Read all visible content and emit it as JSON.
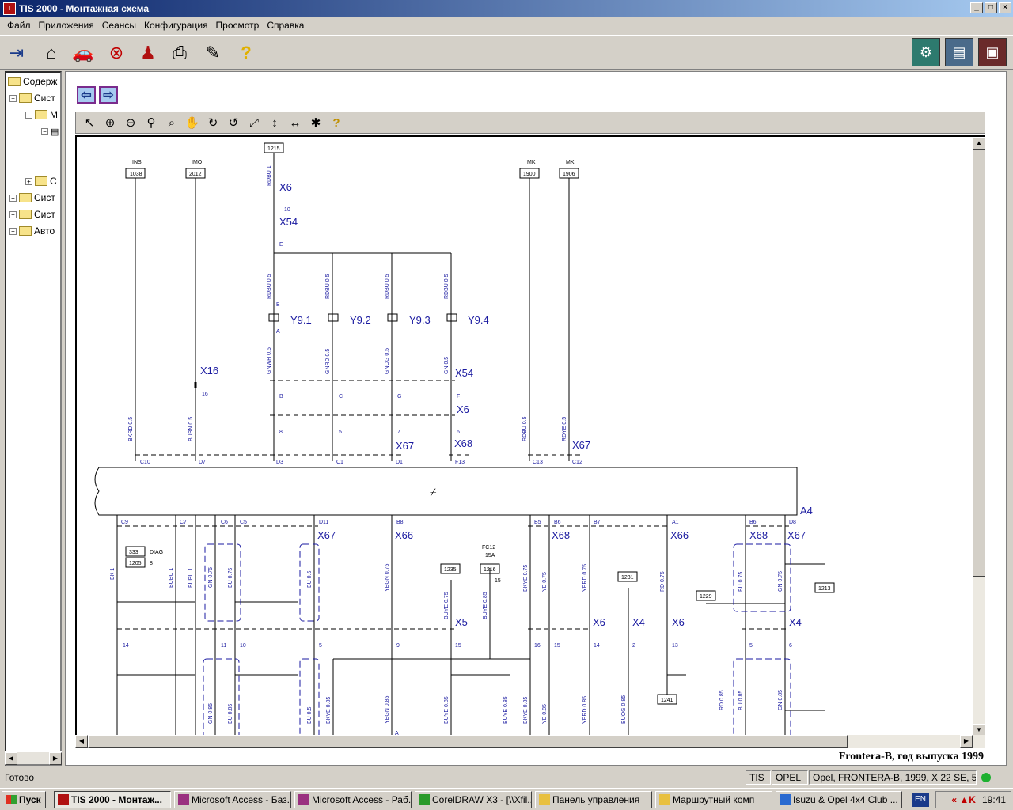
{
  "window": {
    "title": "TIS 2000 - Монтажная схема",
    "controls": [
      "_",
      "□",
      "×"
    ]
  },
  "menu": [
    "Файл",
    "Приложения",
    "Сеансы",
    "Конфигурация",
    "Просмотр",
    "Справка"
  ],
  "toolbar": {
    "icons": [
      "exit-icon",
      "home-icon",
      "car-icon",
      "stop-icon",
      "person-icon",
      "printer-icon",
      "notes-icon",
      "help-icon"
    ],
    "right_icons": [
      "vehicle-app-1-icon",
      "vehicle-app-2-icon",
      "vehicle-app-3-icon"
    ]
  },
  "tree": {
    "items": [
      {
        "label": "Содерж"
      },
      {
        "label": "Сист"
      },
      {
        "label": "М"
      },
      {
        "label": ""
      },
      {
        "label": "С"
      },
      {
        "label": "Сист"
      },
      {
        "label": "Сист"
      },
      {
        "label": "Авто"
      }
    ]
  },
  "viewer_toolbar": {
    "icons": [
      "pointer-icon",
      "zoom-in-icon",
      "zoom-out-icon",
      "zoom-icon",
      "zoom-area-icon",
      "pan-hand-icon",
      "rotate-cw-icon",
      "rotate-ccw-icon",
      "fit-window-icon",
      "fit-height-icon",
      "fit-width-icon",
      "highlight-icon",
      "help-icon"
    ]
  },
  "diagram": {
    "top_boxes": {
      "ins_label": "INS",
      "ins": "1038",
      "imo_label": "IMO",
      "imo": "2012",
      "b1215": "1215",
      "mk1_label": "MK",
      "mk1": "1900",
      "mk2_label": "MK",
      "mk2": "1906"
    },
    "connectors": {
      "x6": "X6",
      "x54": "X54",
      "x16": "X16",
      "x67": "X67",
      "x68": "X68",
      "x66": "X66",
      "x5": "X5",
      "x4": "X4",
      "a4": "A4"
    },
    "valves": [
      "Y9.1",
      "Y9.2",
      "Y9.3",
      "Y9.4"
    ],
    "wires_top": [
      "RDBU 1",
      "RDBU 0.5",
      "RDBU 0.5",
      "RDBU 0.5",
      "RDBU 0.5",
      "GNWH 0.5",
      "GNRD 0.5",
      "GNOG 0.5",
      "GN 0.5",
      "BKRD 0.5",
      "BUBN 0.5",
      "RDBU 0.5",
      "RDYE 0.5"
    ],
    "pins_top": [
      "10",
      "E",
      "B",
      "A",
      "B",
      "C",
      "G",
      "F",
      "8",
      "5",
      "7",
      "6",
      "16",
      "C10",
      "D7",
      "D3",
      "C1",
      "D1",
      "F13",
      "C13",
      "C12"
    ],
    "pins_bottom": [
      "C9",
      "C7",
      "C6",
      "C5",
      "D11",
      "B8",
      "B5",
      "B6",
      "B7",
      "A1",
      "B6",
      "D8"
    ],
    "bottom_boxes": {
      "b333": "333",
      "diag": "DIAG",
      "diag_pin": "8",
      "b1205": "1205",
      "b1235": "1235",
      "fc12": "FC12",
      "fc12_rating": "15A",
      "b1216": "1216",
      "b1216_pin": "15",
      "b1231": "1231",
      "b1229": "1229",
      "b1213": "1213",
      "b1241": "1241"
    },
    "wires_bottom": [
      "BK 1",
      "BUBU 1",
      "BUBU 1",
      "GN 0.75",
      "BU 0.75",
      "BU 0.5",
      "YEGN 0.75",
      "BUYE 0.75",
      "BUYE 0.85",
      "BKYE 0.75",
      "YE 0.75",
      "YERD 0.75",
      "RD 0.75",
      "BU 0.75",
      "GN 0.75",
      "GN 0.85",
      "BU 0.85",
      "BU 0.5",
      "BKYE 0.85",
      "YEGN 0.85",
      "BUYE 0.85",
      "BUYE 0.85",
      "BKYE 0.85",
      "YE 0.85",
      "YERD 0.85",
      "BUOG 0.85",
      "RD 0.85",
      "BU 0.85",
      "GN 0.85"
    ],
    "pins_x5": [
      "14",
      "11",
      "10",
      "5",
      "9",
      "15",
      "16",
      "15",
      "14",
      "2",
      "13",
      "5",
      "6",
      "A"
    ]
  },
  "caption": "Frontera-B, год выпуска 1999",
  "status": {
    "ready": "Готово",
    "tis": "TIS",
    "brand": "OPEL",
    "vehicle": "Opel, FRONTERA-B, 1999, X 22 SE, 5-MT"
  },
  "taskbar": {
    "start": "Пуск",
    "tasks": [
      "TIS 2000 - Монтаж...",
      "Microsoft Access - Баз...",
      "Microsoft Access - Раб...",
      "CorelDRAW X3 - [\\\\Xfil...",
      "Панель управления",
      "Маршрутный комп",
      "Isuzu & Opel 4x4 Club ..."
    ],
    "lang": "EN",
    "time": "19:41"
  }
}
